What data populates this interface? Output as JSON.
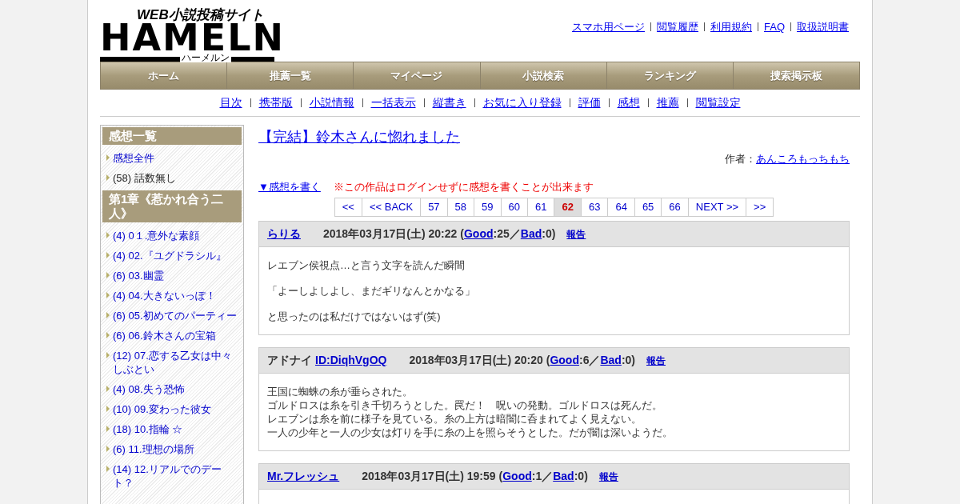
{
  "logo": {
    "tagline": "WEB小説投稿サイト",
    "wordmark": "HAMELN",
    "kana": "ハーメルン"
  },
  "header_links": [
    "スマホ用ページ",
    "閲覧履歴",
    "利用規約",
    "FAQ",
    "取扱説明書"
  ],
  "nav": [
    "ホーム",
    "推薦一覧",
    "マイページ",
    "小説検索",
    "ランキング",
    "捜索掲示板"
  ],
  "sub_nav": [
    "目次",
    "携帯版",
    "小説情報",
    "一括表示",
    "縦書き",
    "お気に入り登録",
    "評価",
    "感想",
    "推薦",
    "閲覧設定"
  ],
  "sidebar": {
    "sections": [
      {
        "heading": "感想一覧",
        "items": [
          {
            "text": "感想全件",
            "link": true
          },
          {
            "text": "(58) 話数無し",
            "link": false
          }
        ]
      },
      {
        "heading": "第1章《惹かれ合う二人》",
        "items": [
          {
            "text": "(4) 0１.意外な素顔",
            "link": true
          },
          {
            "text": "(4) 02.『ユグドラシル』",
            "link": true
          },
          {
            "text": "(6) 03.幽霊",
            "link": true
          },
          {
            "text": "(4) 04.大きないっぽ！",
            "link": true
          },
          {
            "text": "(6) 05.初めてのパーティー",
            "link": true
          },
          {
            "text": "(6) 06.鈴木さんの宝箱",
            "link": true
          },
          {
            "text": "(12) 07.恋する乙女は中々しぶとい",
            "link": true
          },
          {
            "text": "(4) 08.失う恐怖",
            "link": true
          },
          {
            "text": "(10) 09.変わった彼女",
            "link": true
          },
          {
            "text": "(18) 10.指輪 ☆",
            "link": true
          },
          {
            "text": "(6) 11.理想の場所",
            "link": true
          },
          {
            "text": "(14) 12.リアルでのデート？",
            "link": true
          }
        ]
      }
    ]
  },
  "novel": {
    "title": "【完結】鈴木さんに惚れました",
    "author_label": "作者：",
    "author": "あんころもっちもち"
  },
  "write_link": "▼感想を書く",
  "notice": "※この作品はログインせずに感想を書くことが出来ます",
  "pagination": [
    {
      "label": "<<",
      "selected": false
    },
    {
      "label": "<< BACK",
      "selected": false
    },
    {
      "label": "57",
      "selected": false
    },
    {
      "label": "58",
      "selected": false
    },
    {
      "label": "59",
      "selected": false
    },
    {
      "label": "60",
      "selected": false
    },
    {
      "label": "61",
      "selected": false
    },
    {
      "label": "62",
      "selected": true
    },
    {
      "label": "63",
      "selected": false
    },
    {
      "label": "64",
      "selected": false
    },
    {
      "label": "65",
      "selected": false
    },
    {
      "label": "66",
      "selected": false
    },
    {
      "label": "NEXT >>",
      "selected": false
    },
    {
      "label": ">>",
      "selected": false
    }
  ],
  "comments": [
    {
      "author": "らりる",
      "author_linked": true,
      "date": "2018年03月17日(土) 20:22",
      "open": "(",
      "good_label": "Good",
      "good": ":25",
      "divider": "／",
      "bad_label": "Bad",
      "bad": ":0",
      "close": ")",
      "report": "報告",
      "paragraphs": [
        [
          "レエブン侯視点…と言う文字を読んだ瞬間"
        ],
        [
          "「よーしよしよし、まだギリなんとかなる」"
        ],
        [
          "と思ったのは私だけではないはず(笑)"
        ]
      ]
    },
    {
      "author": "アドナイ",
      "author_linked": false,
      "user_id": "ID:DiqhVgOQ",
      "date": "2018年03月17日(土) 20:20",
      "open": "(",
      "good_label": "Good",
      "good": ":6",
      "divider": "／",
      "bad_label": "Bad",
      "bad": ":0",
      "close": ")",
      "report": "報告",
      "paragraphs": [
        [
          "王国に蜘蛛の糸が垂らされた。",
          "ゴルドロスは糸を引き千切ろうとした。罠だ！　呪いの発動。ゴルドロスは死んだ。",
          "レエブンは糸を前に様子を見ている。糸の上方は暗闇に呑まれてよく見えない。",
          "一人の少年と一人の少女は灯りを手に糸の上を照らそうとした。だが闇は深いようだ。"
        ]
      ]
    },
    {
      "author": "Mr.フレッシュ",
      "author_linked": true,
      "date": "2018年03月17日(土) 19:59",
      "open": "(",
      "good_label": "Good",
      "good": ":1",
      "divider": "／",
      "bad_label": "Bad",
      "bad": ":0",
      "close": ")",
      "report": "報告"
    }
  ]
}
